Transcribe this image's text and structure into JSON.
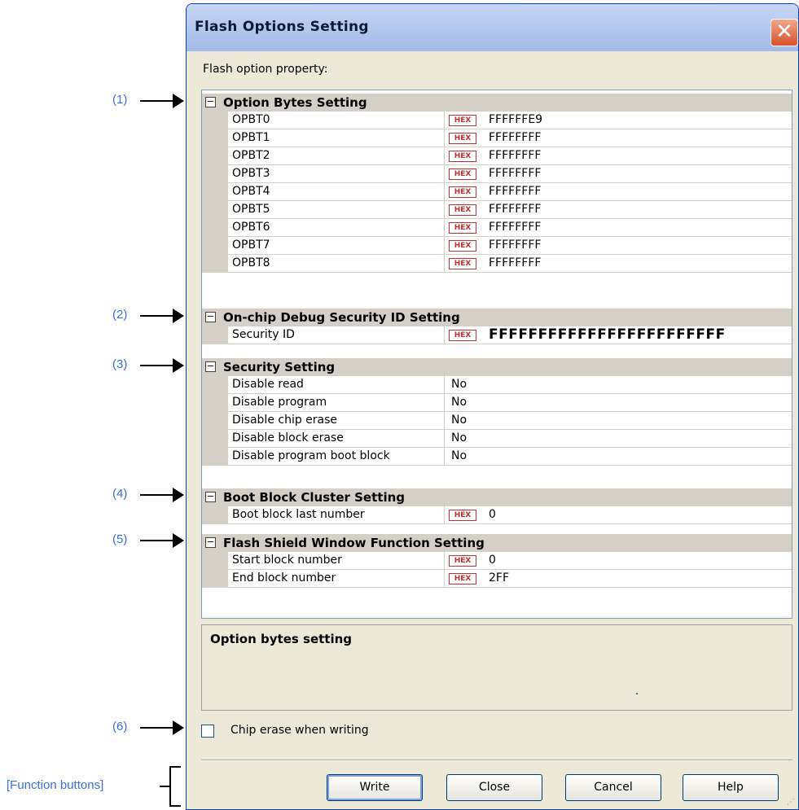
{
  "annotations": {
    "labels": [
      "(1)",
      "(2)",
      "(3)",
      "(4)",
      "(5)",
      "(6)"
    ],
    "function_buttons": "[Function buttons]"
  },
  "dialog": {
    "title": "Flash Options Setting",
    "close_glyph": "✕",
    "property_label": "Flash option property:"
  },
  "categories": {
    "option_bytes": "Option Bytes Setting",
    "debug_id": "On-chip Debug Security ID Setting",
    "security": "Security Setting",
    "boot_block": "Boot Block Cluster Setting",
    "shield": "Flash Shield Window Function Setting"
  },
  "toggle_glyph": "⊟",
  "hex_badge": "HEX",
  "option_bytes": [
    {
      "name": "OPBT0",
      "value": "FFFFFFE9"
    },
    {
      "name": "OPBT1",
      "value": "FFFFFFFF"
    },
    {
      "name": "OPBT2",
      "value": "FFFFFFFF"
    },
    {
      "name": "OPBT3",
      "value": "FFFFFFFF"
    },
    {
      "name": "OPBT4",
      "value": "FFFFFFFF"
    },
    {
      "name": "OPBT5",
      "value": "FFFFFFFF"
    },
    {
      "name": "OPBT6",
      "value": "FFFFFFFF"
    },
    {
      "name": "OPBT7",
      "value": "FFFFFFFF"
    },
    {
      "name": "OPBT8",
      "value": "FFFFFFFF"
    }
  ],
  "debug_id": {
    "name": "Security ID",
    "value": "FFFFFFFFFFFFFFFFFFFFFFFF"
  },
  "security": [
    {
      "name": "Disable read",
      "value": "No"
    },
    {
      "name": "Disable program",
      "value": "No"
    },
    {
      "name": "Disable chip erase",
      "value": "No"
    },
    {
      "name": "Disable block erase",
      "value": "No"
    },
    {
      "name": "Disable program boot block",
      "value": "No"
    }
  ],
  "boot_block": {
    "name": "Boot block last number",
    "value": "0"
  },
  "shield": [
    {
      "name": "Start block number",
      "value": "0"
    },
    {
      "name": "End block number",
      "value": "2FF"
    }
  ],
  "description": {
    "title": "Option bytes setting",
    "dot": "."
  },
  "checkbox": {
    "label": "Chip erase when writing",
    "checked": false
  },
  "buttons": {
    "write": "Write",
    "close": "Close",
    "cancel": "Cancel",
    "help": "Help"
  },
  "colors": {
    "annotation": "#3a6fd8",
    "hex_badge": "#c03030",
    "category_bg": "#d4d0c8",
    "dialog_bg": "#ece9d8"
  }
}
